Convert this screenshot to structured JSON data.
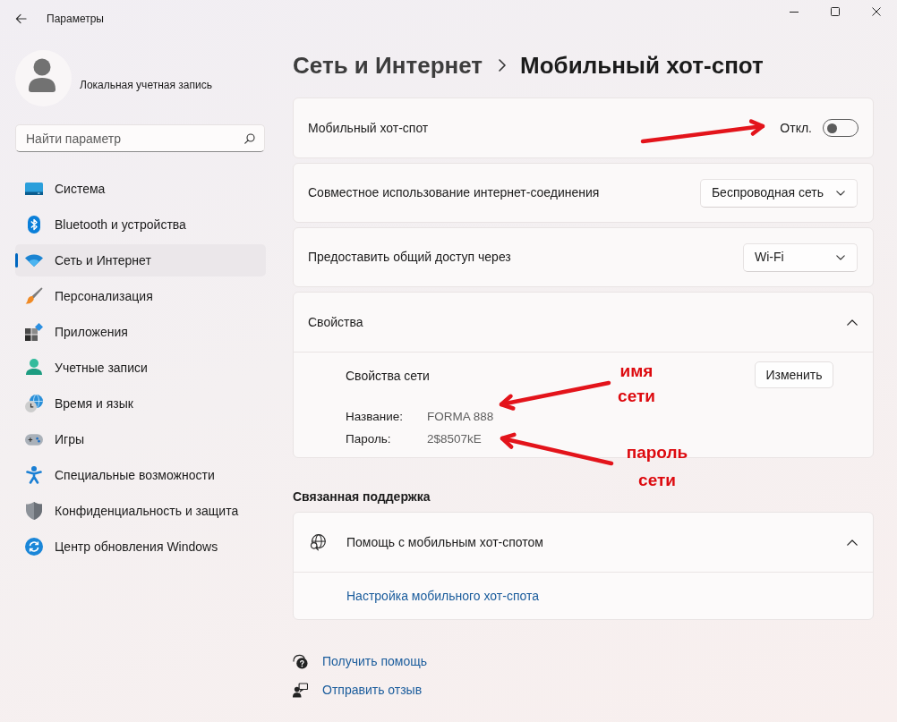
{
  "window": {
    "title": "Параметры"
  },
  "account": {
    "name": "Локальная учетная запись"
  },
  "search": {
    "placeholder": "Найти параметр"
  },
  "sidebar": {
    "items": [
      {
        "label": "Система",
        "selected": false
      },
      {
        "label": "Bluetooth и устройства",
        "selected": false
      },
      {
        "label": "Сеть и Интернет",
        "selected": true
      },
      {
        "label": "Персонализация",
        "selected": false
      },
      {
        "label": "Приложения",
        "selected": false
      },
      {
        "label": "Учетные записи",
        "selected": false
      },
      {
        "label": "Время и язык",
        "selected": false
      },
      {
        "label": "Игры",
        "selected": false
      },
      {
        "label": "Специальные возможности",
        "selected": false
      },
      {
        "label": "Конфиденциальность и защита",
        "selected": false
      },
      {
        "label": "Центр обновления Windows",
        "selected": false
      }
    ]
  },
  "breadcrumb": {
    "parent": "Сеть и Интернет",
    "current": "Мобильный хот-спот"
  },
  "settings": [
    {
      "kind": "toggle",
      "label": "Мобильный хот-спот",
      "state_text": "Откл.",
      "on": false
    },
    {
      "kind": "dropdown",
      "label": "Совместное использование интернет-соединения",
      "value": "Беспроводная сеть"
    },
    {
      "kind": "dropdown",
      "label": "Предоставить общий доступ через",
      "value": "Wi-Fi"
    },
    {
      "kind": "expander",
      "label": "Свойства",
      "expanded": true,
      "content": {
        "title": "Свойства сети",
        "button": "Изменить",
        "fields": [
          {
            "label": "Название:",
            "value": "FORMA 888"
          },
          {
            "label": "Пароль:",
            "value": "2$8507kE"
          }
        ]
      }
    }
  ],
  "related_support": {
    "heading": "Связанная поддержка",
    "items": [
      {
        "label": "Помощь с мобильным хот-спотом",
        "expanded": true,
        "links": [
          "Настройка мобильного хот-спота"
        ]
      }
    ]
  },
  "footer_links": [
    {
      "label": "Получить помощь"
    },
    {
      "label": "Отправить отзыв"
    }
  ],
  "annotations": [
    {
      "text": "имя сети"
    },
    {
      "text": "пароль сети"
    }
  ]
}
